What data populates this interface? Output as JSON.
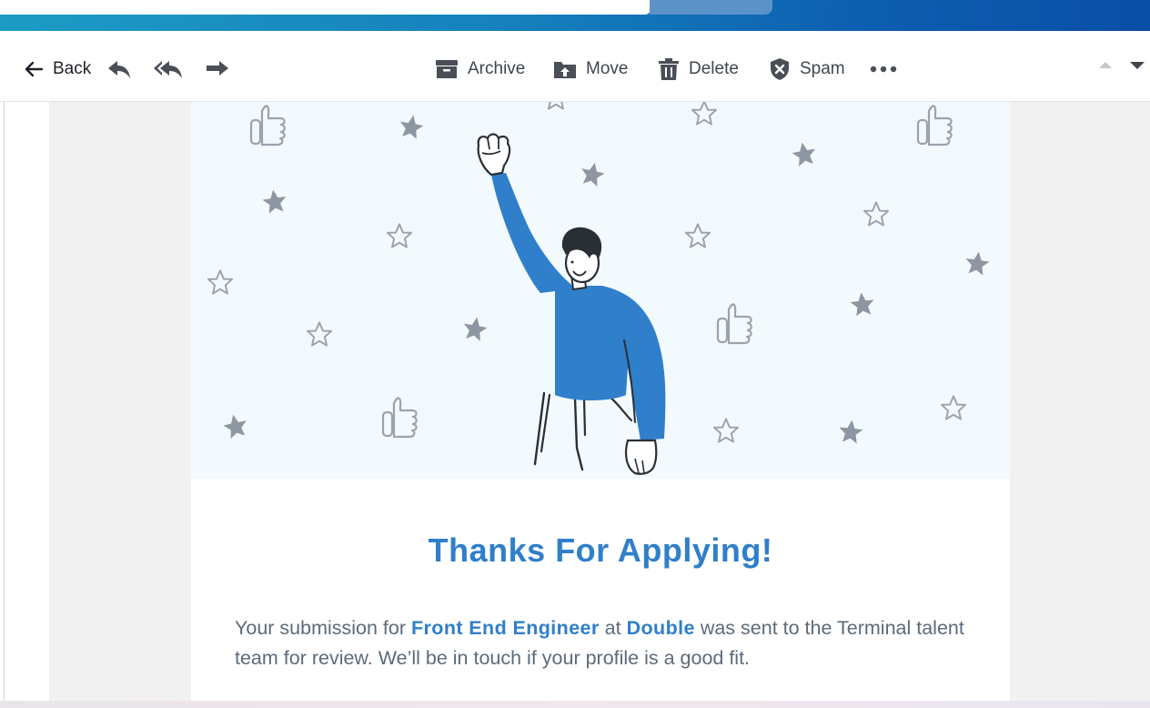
{
  "toolbar": {
    "back_label": "Back",
    "archive_label": "Archive",
    "move_label": "Move",
    "delete_label": "Delete",
    "spam_label": "Spam"
  },
  "email": {
    "heading": "Thanks For Applying!",
    "body_prefix": "Your submission for ",
    "role": "Front End Engineer",
    "body_mid": " at ",
    "company": "Double",
    "body_suffix": " was sent to the Terminal talent team for review. We’ll be in touch if your profile is a good fit."
  },
  "colors": {
    "accent": "#2f7fca",
    "header_gradient_start": "#1d9bc4",
    "header_gradient_end": "#0a4ea6",
    "body_text": "#5b6b7a"
  }
}
